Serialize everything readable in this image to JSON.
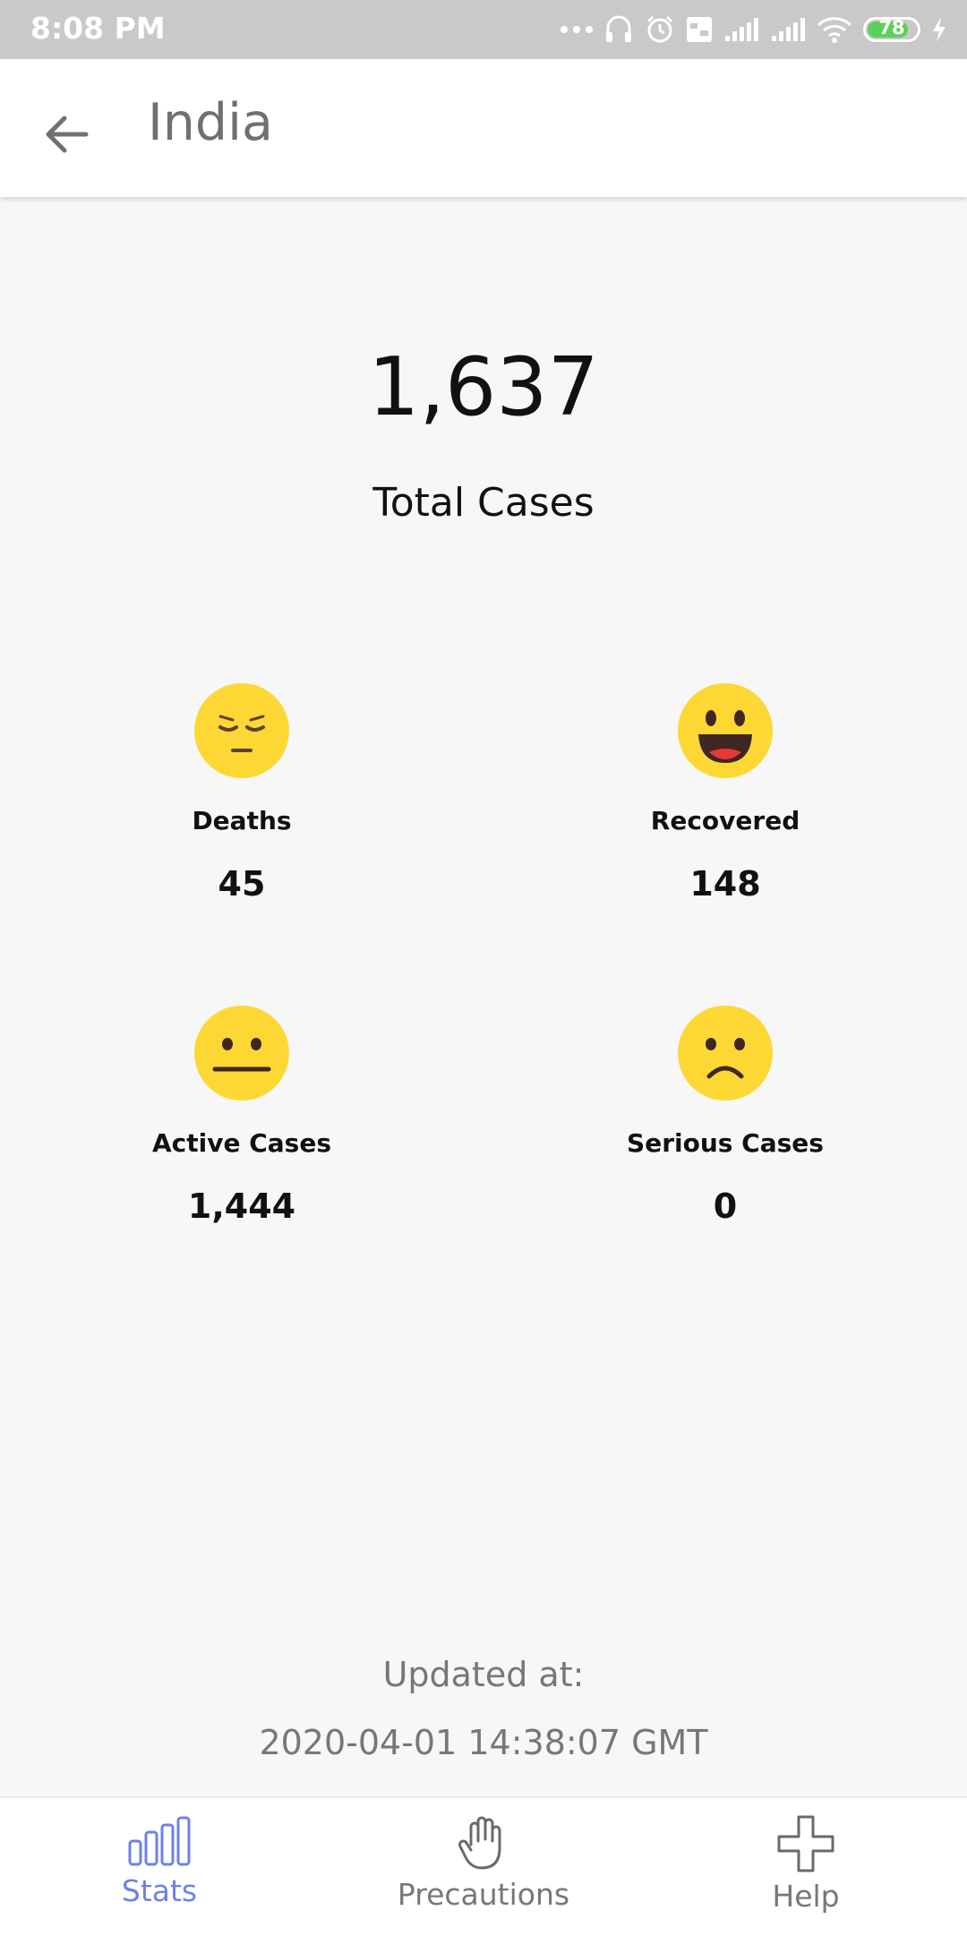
{
  "status_bar": {
    "time": "8:08 PM",
    "battery": "78",
    "icons": [
      "more-icon",
      "headset-icon",
      "alarm-icon",
      "volte-icon",
      "signal-icon",
      "signal-icon",
      "wifi-icon",
      "battery-icon",
      "charging-icon"
    ]
  },
  "header": {
    "title": "India",
    "back_icon": "arrow-back-icon"
  },
  "summary": {
    "total_value": "1,637",
    "total_label": "Total Cases"
  },
  "stats": {
    "deaths": {
      "label": "Deaths",
      "value": "45",
      "icon": "pensive-face-icon"
    },
    "recovered": {
      "label": "Recovered",
      "value": "148",
      "icon": "grinning-face-icon"
    },
    "active": {
      "label": "Active Cases",
      "value": "1,444",
      "icon": "neutral-face-icon"
    },
    "serious": {
      "label": "Serious Cases",
      "value": "0",
      "icon": "frowning-face-icon"
    }
  },
  "updated": {
    "label": "Updated at:",
    "value": "2020-04-01 14:38:07 GMT"
  },
  "bottom_nav": {
    "items": [
      {
        "label": "Stats",
        "icon": "bar-chart-icon",
        "active": true
      },
      {
        "label": "Precautions",
        "icon": "hand-icon",
        "active": false
      },
      {
        "label": "Help",
        "icon": "plus-icon",
        "active": false
      }
    ]
  },
  "colors": {
    "accent": "#6f82e2",
    "emoji_yellow": "#fdd835",
    "status_bar": "#c9c9c9",
    "background": "#f7f7f7"
  }
}
